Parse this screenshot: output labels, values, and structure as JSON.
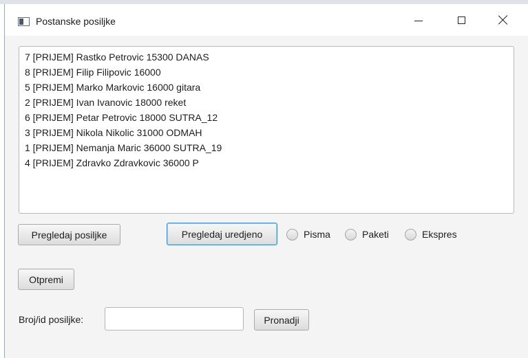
{
  "window": {
    "title": "Postanske posiljke",
    "icon": "app-window-icon",
    "controls": {
      "minimize_icon": "minimize-icon",
      "maximize_icon": "maximize-icon",
      "close_icon": "close-icon"
    }
  },
  "list": {
    "items": [
      "7 [PRIJEM] Rastko Petrovic 15300 DANAS",
      "8 [PRIJEM] Filip Filipovic 16000",
      "5 [PRIJEM] Marko Markovic 16000 gitara",
      "2 [PRIJEM] Ivan Ivanovic 18000 reket",
      "6 [PRIJEM] Petar Petrovic 18000 SUTRA_12",
      "3 [PRIJEM] Nikola Nikolic 31000 ODMAH",
      "1 [PRIJEM] Nemanja Maric 36000 SUTRA_19",
      "4 [PRIJEM] Zdravko Zdravkovic 36000 P"
    ]
  },
  "controls": {
    "pregledaj_label": "Pregledaj posiljke",
    "uredjeno_label": "Pregledaj uredjeno",
    "radio": {
      "pisma": "Pisma",
      "paketi": "Paketi",
      "ekspres": "Ekspres"
    },
    "otpremi_label": "Otpremi",
    "id_label": "Broj/id posiljke:",
    "id_value": "",
    "pronadji_label": "Pronadji"
  },
  "colors": {
    "focus_border": "#3c8fd6",
    "window_bg": "#f4f4f4"
  }
}
